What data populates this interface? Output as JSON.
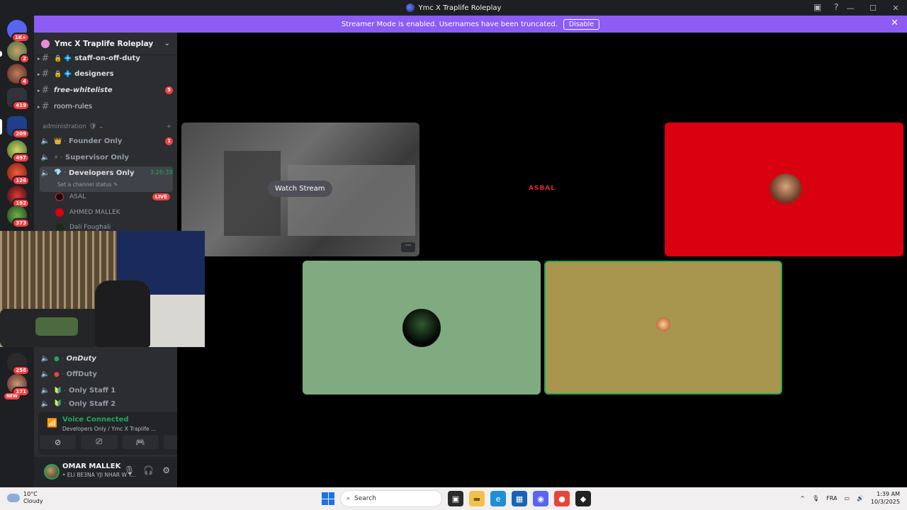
{
  "window": {
    "title": "Ymc X Traplife Roleplay",
    "controls": [
      "—",
      "☐",
      "✕"
    ]
  },
  "banner": {
    "text": "Streamer Mode is enabled. Usernames have been truncated.",
    "disable_label": "Disable",
    "color": "#8c5cf5"
  },
  "servers": [
    {
      "badge": "1K+"
    },
    {
      "badge": "2"
    },
    {
      "badge": "4"
    },
    {
      "badge": "419"
    },
    {
      "badge": "209"
    },
    {
      "badge": "497"
    },
    {
      "badge": "126"
    },
    {
      "badge": "192"
    },
    {
      "badge": "373"
    },
    {
      "badge": "256"
    },
    {
      "badge": "171",
      "new": "NEW"
    }
  ],
  "guild": {
    "name": "Ymc X Traplife Roleplay"
  },
  "channels": [
    {
      "name": "staff-on-off-duty"
    },
    {
      "name": "designers"
    },
    {
      "name": "free-whiteliste",
      "badge": "5"
    },
    {
      "name": "room-rules"
    }
  ],
  "category": {
    "name": "administration",
    "suffix": "🛡 ⌄",
    "add": "+"
  },
  "voice_channels": [
    {
      "name": "Founder Only",
      "badge": "1"
    },
    {
      "name": "Supervisor Only"
    },
    {
      "name": "Developers Only",
      "timer": "3:26:38",
      "status_hint": "Set a channel status ✎"
    }
  ],
  "voice_users": [
    {
      "name": "ASAL",
      "live": "LIVE"
    },
    {
      "name": "AHMED MALLEK"
    },
    {
      "name": "Dali Foughali"
    }
  ],
  "lower_channels": [
    {
      "name": "OnDuty"
    },
    {
      "name": "OffDuty"
    },
    {
      "name": "Only Staff 1"
    },
    {
      "name": "Only Staff 2"
    }
  ],
  "voice_panel": {
    "status": "Voice Connected",
    "location": "Developers Only / Ymc X Traplife ..."
  },
  "user_panel": {
    "name": "OMAR MALLEK",
    "status": "• ELI BE3NA YJI NHAR W Y..."
  },
  "stage": {
    "watch_label": "Watch Stream",
    "more_label": "···",
    "logo_text": "ASBAL"
  },
  "taskbar": {
    "temp": "10°C",
    "weather": "Cloudy",
    "search_placeholder": "Search",
    "lang": "FRA",
    "time": "1:39 AM",
    "date": "10/3/2025"
  }
}
